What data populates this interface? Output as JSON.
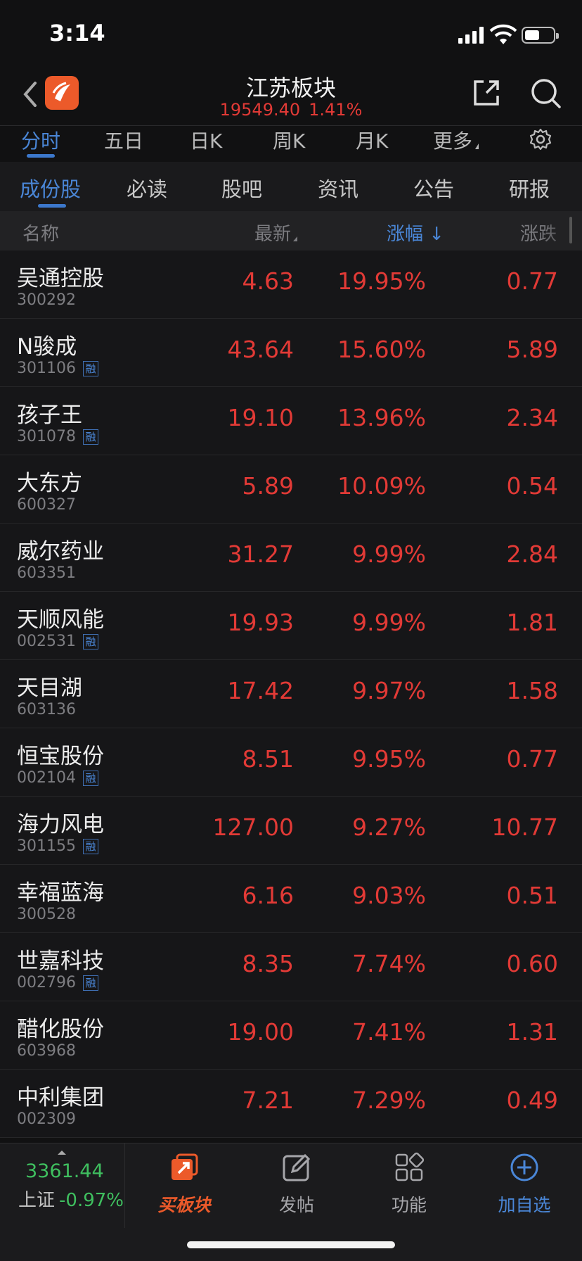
{
  "status_bar": {
    "time": "3:14"
  },
  "header": {
    "title": "江苏板块",
    "index_value": "19549.40",
    "index_change": "1.41%"
  },
  "period_tabs": [
    {
      "label": "分时",
      "active": true
    },
    {
      "label": "五日"
    },
    {
      "label": "日K"
    },
    {
      "label": "周K"
    },
    {
      "label": "月K"
    },
    {
      "label": "更多"
    }
  ],
  "content_tabs": [
    {
      "label": "成份股",
      "active": true
    },
    {
      "label": "必读"
    },
    {
      "label": "股吧"
    },
    {
      "label": "资讯"
    },
    {
      "label": "公告"
    },
    {
      "label": "研报"
    }
  ],
  "columns": {
    "name": "名称",
    "last": "最新",
    "pct": "涨幅",
    "chg": "涨跌"
  },
  "rows": [
    {
      "name": "吴通控股",
      "code": "300292",
      "rong": false,
      "last": "4.63",
      "pct": "19.95%",
      "chg": "0.77"
    },
    {
      "name": "N骏成",
      "code": "301106",
      "rong": true,
      "last": "43.64",
      "pct": "15.60%",
      "chg": "5.89"
    },
    {
      "name": "孩子王",
      "code": "301078",
      "rong": true,
      "last": "19.10",
      "pct": "13.96%",
      "chg": "2.34"
    },
    {
      "name": "大东方",
      "code": "600327",
      "rong": false,
      "last": "5.89",
      "pct": "10.09%",
      "chg": "0.54"
    },
    {
      "name": "威尔药业",
      "code": "603351",
      "rong": false,
      "last": "31.27",
      "pct": "9.99%",
      "chg": "2.84"
    },
    {
      "name": "天顺风能",
      "code": "002531",
      "rong": true,
      "last": "19.93",
      "pct": "9.99%",
      "chg": "1.81"
    },
    {
      "name": "天目湖",
      "code": "603136",
      "rong": false,
      "last": "17.42",
      "pct": "9.97%",
      "chg": "1.58"
    },
    {
      "name": "恒宝股份",
      "code": "002104",
      "rong": true,
      "last": "8.51",
      "pct": "9.95%",
      "chg": "0.77"
    },
    {
      "name": "海力风电",
      "code": "301155",
      "rong": true,
      "last": "127.00",
      "pct": "9.27%",
      "chg": "10.77"
    },
    {
      "name": "幸福蓝海",
      "code": "300528",
      "rong": false,
      "last": "6.16",
      "pct": "9.03%",
      "chg": "0.51"
    },
    {
      "name": "世嘉科技",
      "code": "002796",
      "rong": true,
      "last": "8.35",
      "pct": "7.74%",
      "chg": "0.60"
    },
    {
      "name": "醋化股份",
      "code": "603968",
      "rong": false,
      "last": "19.00",
      "pct": "7.41%",
      "chg": "1.31"
    },
    {
      "name": "中利集团",
      "code": "002309",
      "rong": false,
      "last": "7.21",
      "pct": "7.29%",
      "chg": "0.49"
    }
  ],
  "rong_label": "融",
  "bottom_bar": {
    "index_value": "3361.44",
    "index_name": "上证",
    "index_change": "-0.97%",
    "buy_label": "买板块",
    "post_label": "发帖",
    "func_label": "功能",
    "add_label": "加自选"
  },
  "colors": {
    "up": "#e23a36",
    "down": "#3fbf5f",
    "accent": "#4a86d6",
    "brand": "#ec5a2a"
  }
}
